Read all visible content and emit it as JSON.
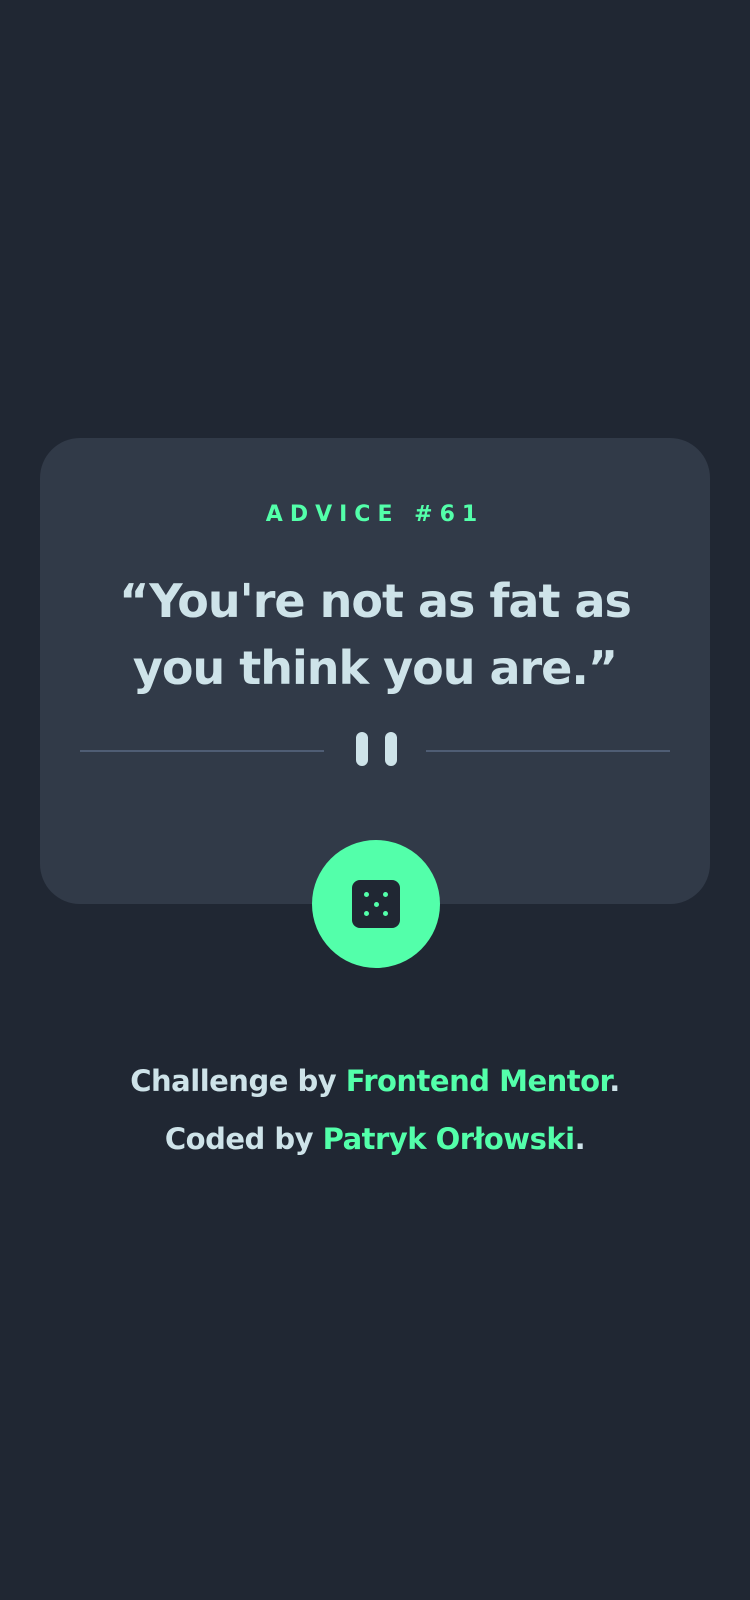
{
  "card": {
    "advice_label": "ADVICE #61",
    "quote": "“You're not as fat as you think you are.”"
  },
  "dice_button": {
    "icon": "dice-icon",
    "pips": 5
  },
  "footer": {
    "challenge_prefix": "Challenge by ",
    "challenge_link": "Frontend Mentor",
    "challenge_suffix": ".",
    "coded_prefix": "Coded by ",
    "coded_link": "Patryk Orłowski",
    "coded_suffix": "."
  },
  "colors": {
    "background": "#202733",
    "card": "#313a48",
    "accent": "#53ffaa",
    "text": "#cee3e9",
    "divider": "#4f5d74"
  }
}
